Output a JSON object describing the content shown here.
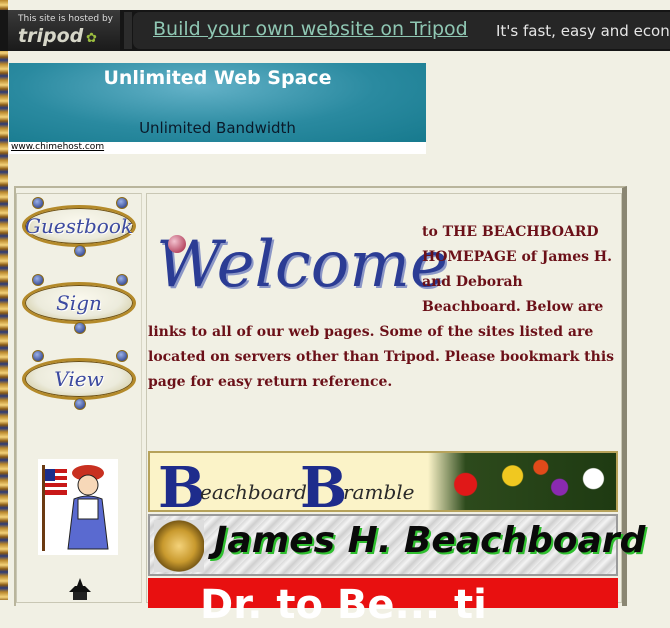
{
  "tripod_bar": {
    "hosted_text": "This site is hosted by",
    "logo_text": "tripod",
    "build_link": "Build your own website on Tripod",
    "tagline": "It's fast, easy and econom"
  },
  "ad_banner": {
    "title": "Unlimited Web Space",
    "subtitle": "Unlimited Bandwidth",
    "link": "www.chimehost.com"
  },
  "nav": {
    "guestbook": "Guestbook",
    "sign": "Sign",
    "view": "View"
  },
  "welcome": {
    "heading": "Welcome",
    "text": "to THE BEACHBOARD HOMEPAGE of James H. and Deborah Beachboard. Below are links to all of our web pages. Some of the sites listed are located on servers other than Tripod. Please bookmark this page for easy return reference."
  },
  "banners": {
    "bramble_b1": "B",
    "bramble_w1": "eachboard",
    "bramble_b2": "B",
    "bramble_w2": "ramble",
    "james": "James H. Beachboard",
    "red": "Dr. to Be... ti"
  },
  "colors": {
    "page_bg": "#f1f0e4",
    "text_maroon": "#6b1018",
    "welcome_blue": "#2b3c94",
    "tripod_link": "#8fc7b3"
  }
}
